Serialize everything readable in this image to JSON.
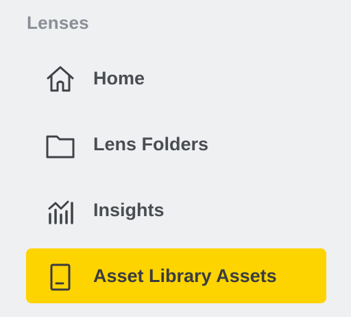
{
  "sidebar": {
    "section_title": "Lenses",
    "items": [
      {
        "label": "Home",
        "icon": "home-icon",
        "active": false
      },
      {
        "label": "Lens Folders",
        "icon": "folder-icon",
        "active": false
      },
      {
        "label": "Insights",
        "icon": "insights-chart-icon",
        "active": false
      },
      {
        "label": "Asset Library Assets",
        "icon": "asset-library-icon",
        "active": true
      }
    ],
    "colors": {
      "background": "#eff0f2",
      "active_background": "#fed400",
      "section_title": "#8a8e95",
      "label": "#4a4d52"
    }
  }
}
